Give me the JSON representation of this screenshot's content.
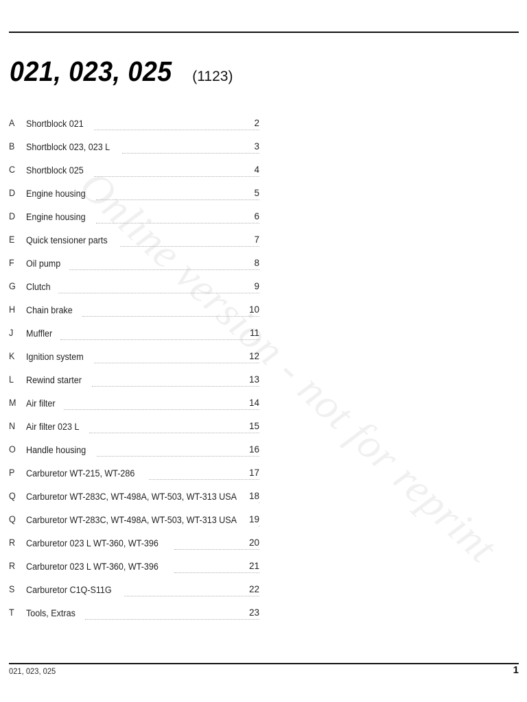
{
  "document": {
    "title_main": "021, 023, 025",
    "title_code": "(1123)"
  },
  "watermark": {
    "text": "Online version - not for reprint"
  },
  "toc": {
    "entries": [
      {
        "letter": "A",
        "label": "Shortblock 021",
        "page": "2"
      },
      {
        "letter": "B",
        "label": "Shortblock 023, 023 L",
        "page": "3"
      },
      {
        "letter": "C",
        "label": "Shortblock 025",
        "page": "4"
      },
      {
        "letter": "D",
        "label": "Engine housing",
        "page": "5"
      },
      {
        "letter": "D",
        "label": "Engine housing",
        "page": "6"
      },
      {
        "letter": "E",
        "label": "Quick tensioner parts",
        "page": "7"
      },
      {
        "letter": "F",
        "label": "Oil pump",
        "page": "8"
      },
      {
        "letter": "G",
        "label": "Clutch",
        "page": "9"
      },
      {
        "letter": "H",
        "label": "Chain brake",
        "page": "10"
      },
      {
        "letter": "J",
        "label": "Muffler",
        "page": "11"
      },
      {
        "letter": "K",
        "label": "Ignition system",
        "page": "12"
      },
      {
        "letter": "L",
        "label": "Rewind starter",
        "page": "13"
      },
      {
        "letter": "M",
        "label": "Air filter",
        "page": "14"
      },
      {
        "letter": "N",
        "label": "Air filter 023 L",
        "page": "15"
      },
      {
        "letter": "O",
        "label": "Handle housing",
        "page": "16"
      },
      {
        "letter": "P",
        "label": "Carburetor WT-215, WT-286",
        "page": "17"
      },
      {
        "letter": "Q",
        "label": "Carburetor WT-283C, WT-498A, WT-503, WT-313 USA",
        "page": "18"
      },
      {
        "letter": "Q",
        "label": "Carburetor WT-283C, WT-498A, WT-503, WT-313 USA",
        "page": "19"
      },
      {
        "letter": "R",
        "label": "Carburetor 023 L WT-360, WT-396",
        "page": "20"
      },
      {
        "letter": "R",
        "label": "Carburetor 023 L WT-360, WT-396",
        "page": "21"
      },
      {
        "letter": "S",
        "label": "Carburetor C1Q-S11G",
        "page": "22"
      },
      {
        "letter": "T",
        "label": "Tools, Extras",
        "page": "23"
      }
    ]
  },
  "footer": {
    "left_text": "021, 023, 025",
    "page_number": "1"
  }
}
